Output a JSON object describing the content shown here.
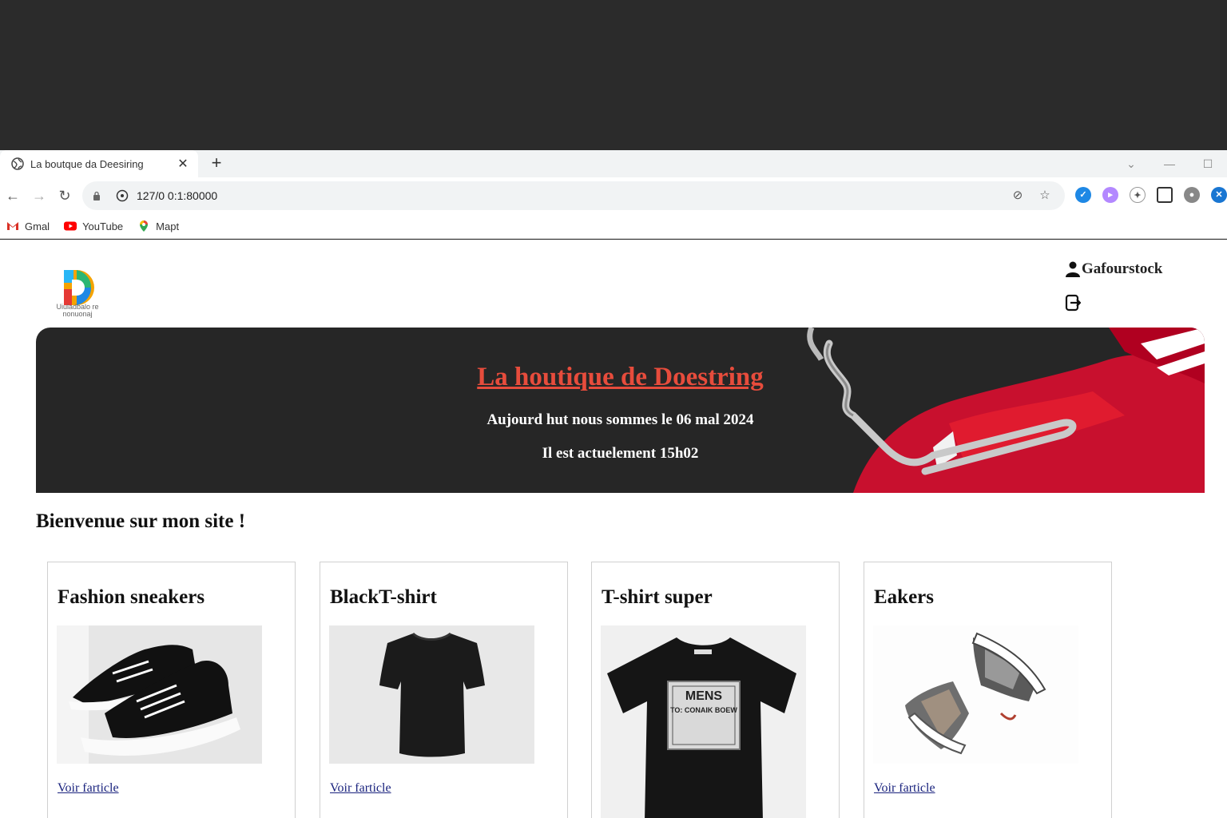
{
  "browser": {
    "tab_title": "La boutque da Deesiring",
    "url": "127/0 0:1:80000",
    "bookmarks": [
      {
        "label": "Gmal",
        "icon": "gmail-icon"
      },
      {
        "label": "YouTube",
        "icon": "youtube-icon"
      },
      {
        "label": "Mapt",
        "icon": "maps-icon"
      }
    ]
  },
  "site": {
    "logo_text_1": "Uiuladbalo re",
    "logo_text_2": "nonuonaj",
    "user_name": "Gafourstock",
    "banner": {
      "title": "La houtique de Doestring",
      "date_line": "Aujourd hut nous sommes le 06 mal 2024",
      "time_line": "Il est actuelement 15h02"
    },
    "welcome": "Bienvenue sur mon site !",
    "products": [
      {
        "title": "Fashion sneakers",
        "link": "Voir farticle"
      },
      {
        "title": "BlackT-shirt",
        "link": "Voir farticle"
      },
      {
        "title": "T-shirt super",
        "link": "Voir farticle",
        "print_text_1": "MENS",
        "print_text_2": "TO: CONAIK BOEW"
      },
      {
        "title": "Eakers",
        "link": "Voir farticle"
      }
    ]
  },
  "colors": {
    "accent_red": "#e74c3c",
    "banner_bg": "#262626",
    "link_blue": "#1a237e"
  }
}
